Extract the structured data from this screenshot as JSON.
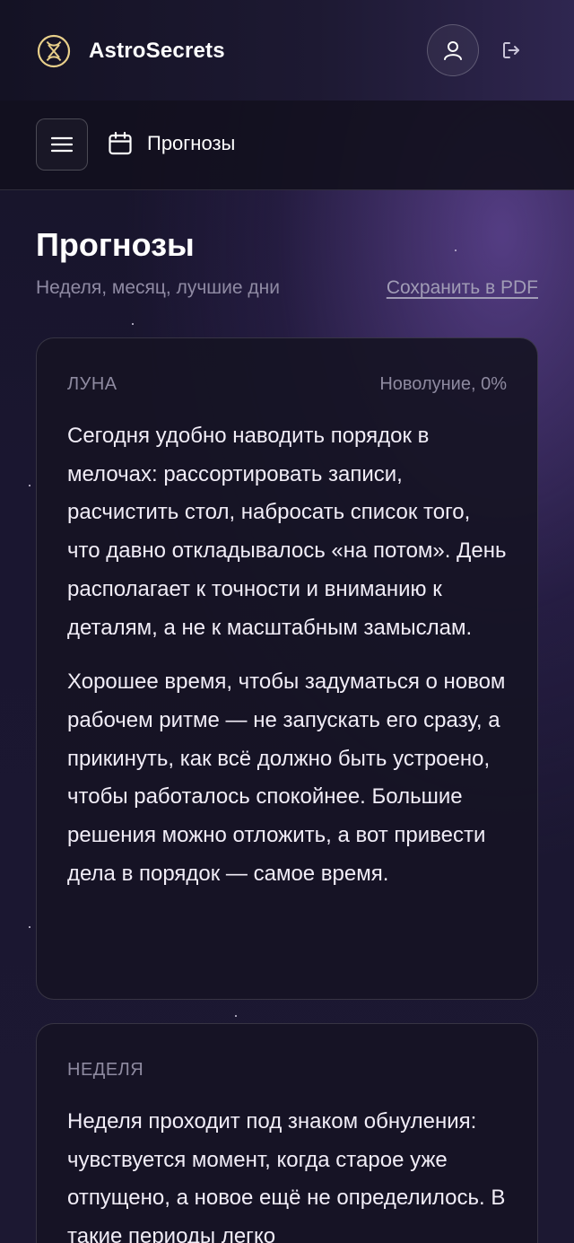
{
  "header": {
    "brand_name": "AstroSecrets",
    "icons": {
      "logo": "astro-logo-icon",
      "profile": "user-icon",
      "logout": "logout-icon"
    }
  },
  "subnav": {
    "menu_icon": "menu-icon",
    "crumb_icon": "calendar-icon",
    "crumb_label": "Прогнозы"
  },
  "page": {
    "title": "Прогнозы",
    "subtitle": "Неделя, месяц, лучшие дни",
    "pdf_link": "Сохранить в PDF"
  },
  "cards": [
    {
      "kicker": "ЛУНА",
      "meta": "Новолуние, 0%",
      "paragraphs": [
        "Сегодня удобно наводить порядок в мелочах: рассортировать записи, расчистить стол, набросать список того, что давно откладывалось «на потом». День располагает к точности и вниманию к деталям, а не к масштабным замыслам.",
        "Хорошее время, чтобы задуматься о новом рабочем ритме — не запускать его сразу, а прикинуть, как всё должно быть устроено, чтобы работалось спокойнее. Большие решения можно отложить, а вот привести дела в порядок — самое время."
      ]
    },
    {
      "kicker": "НЕДЕЛЯ",
      "paragraphs": [
        "Неделя проходит под знаком обнуления: чувствуется момент, когда старое уже отпущено, а новое ещё не определилось. В такие периоды легко"
      ]
    }
  ],
  "colors": {
    "background": "#1a1630",
    "accent_purple": "#684aa0",
    "text": "#f1edf7",
    "muted": "#8e8aa0",
    "logo_gold": "#e8cf8a"
  }
}
